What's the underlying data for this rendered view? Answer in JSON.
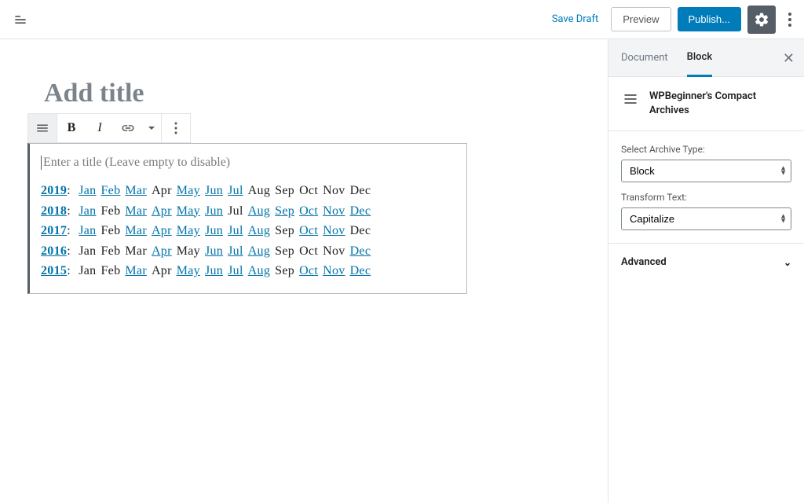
{
  "toolbar": {
    "save_draft": "Save Draft",
    "preview": "Preview",
    "publish": "Publish..."
  },
  "editor": {
    "title_placeholder": "Add title",
    "archive_title_placeholder": "Enter a title (Leave empty to disable)",
    "archive_rows": [
      {
        "year": "2019",
        "months": [
          {
            "label": "Jan",
            "linked": true
          },
          {
            "label": "Feb",
            "linked": true
          },
          {
            "label": "Mar",
            "linked": true
          },
          {
            "label": "Apr",
            "linked": false
          },
          {
            "label": "May",
            "linked": true
          },
          {
            "label": "Jun",
            "linked": true
          },
          {
            "label": "Jul",
            "linked": true
          },
          {
            "label": "Aug",
            "linked": false
          },
          {
            "label": "Sep",
            "linked": false
          },
          {
            "label": "Oct",
            "linked": false
          },
          {
            "label": "Nov",
            "linked": false
          },
          {
            "label": "Dec",
            "linked": false
          }
        ]
      },
      {
        "year": "2018",
        "months": [
          {
            "label": "Jan",
            "linked": true
          },
          {
            "label": "Feb",
            "linked": false
          },
          {
            "label": "Mar",
            "linked": true
          },
          {
            "label": "Apr",
            "linked": true
          },
          {
            "label": "May",
            "linked": true
          },
          {
            "label": "Jun",
            "linked": true
          },
          {
            "label": "Jul",
            "linked": false
          },
          {
            "label": "Aug",
            "linked": true
          },
          {
            "label": "Sep",
            "linked": true
          },
          {
            "label": "Oct",
            "linked": true
          },
          {
            "label": "Nov",
            "linked": true
          },
          {
            "label": "Dec",
            "linked": true
          }
        ]
      },
      {
        "year": "2017",
        "months": [
          {
            "label": "Jan",
            "linked": true
          },
          {
            "label": "Feb",
            "linked": false
          },
          {
            "label": "Mar",
            "linked": true
          },
          {
            "label": "Apr",
            "linked": true
          },
          {
            "label": "May",
            "linked": true
          },
          {
            "label": "Jun",
            "linked": true
          },
          {
            "label": "Jul",
            "linked": true
          },
          {
            "label": "Aug",
            "linked": true
          },
          {
            "label": "Sep",
            "linked": false
          },
          {
            "label": "Oct",
            "linked": true
          },
          {
            "label": "Nov",
            "linked": true
          },
          {
            "label": "Dec",
            "linked": false
          }
        ]
      },
      {
        "year": "2016",
        "months": [
          {
            "label": "Jan",
            "linked": false
          },
          {
            "label": "Feb",
            "linked": false
          },
          {
            "label": "Mar",
            "linked": false
          },
          {
            "label": "Apr",
            "linked": true
          },
          {
            "label": "May",
            "linked": false
          },
          {
            "label": "Jun",
            "linked": true
          },
          {
            "label": "Jul",
            "linked": true
          },
          {
            "label": "Aug",
            "linked": true
          },
          {
            "label": "Sep",
            "linked": false
          },
          {
            "label": "Oct",
            "linked": false
          },
          {
            "label": "Nov",
            "linked": false
          },
          {
            "label": "Dec",
            "linked": true
          }
        ]
      },
      {
        "year": "2015",
        "months": [
          {
            "label": "Jan",
            "linked": false
          },
          {
            "label": "Feb",
            "linked": false
          },
          {
            "label": "Mar",
            "linked": true
          },
          {
            "label": "Apr",
            "linked": false
          },
          {
            "label": "May",
            "linked": true
          },
          {
            "label": "Jun",
            "linked": true
          },
          {
            "label": "Jul",
            "linked": true
          },
          {
            "label": "Aug",
            "linked": true
          },
          {
            "label": "Sep",
            "linked": false
          },
          {
            "label": "Oct",
            "linked": true
          },
          {
            "label": "Nov",
            "linked": true
          },
          {
            "label": "Dec",
            "linked": true
          }
        ]
      }
    ],
    "block_toolbar": {
      "bold": "B",
      "italic": "I"
    }
  },
  "sidebar": {
    "tabs": {
      "document": "Document",
      "block": "Block"
    },
    "block_name": "WPBeginner's Compact Archives",
    "archive_type_label": "Select Archive Type:",
    "archive_type_value": "Block",
    "transform_label": "Transform Text:",
    "transform_value": "Capitalize",
    "advanced": "Advanced"
  }
}
